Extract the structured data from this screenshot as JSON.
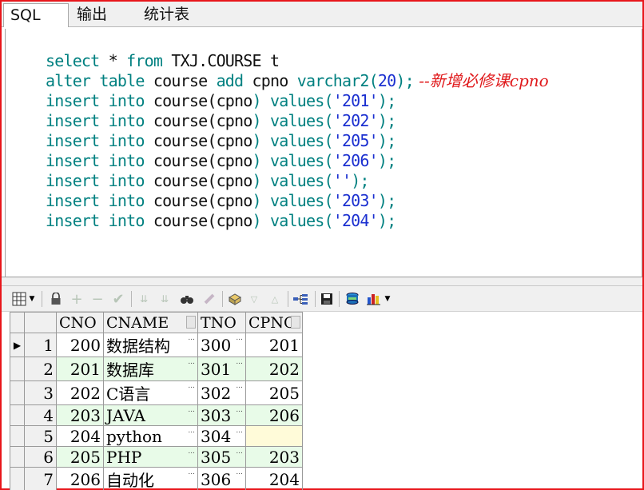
{
  "tabs": [
    {
      "label": "SQL"
    },
    {
      "label": "输出"
    },
    {
      "label": "统计表"
    }
  ],
  "editor": {
    "lines": [
      {
        "t1": "select",
        "t2": " * ",
        "t3": "from",
        "t4": " TXJ.COURSE t"
      },
      {
        "kw1": "alter table",
        "obj1": " course ",
        "kw2": "add",
        "obj2": " cpno ",
        "kw3": "varchar2(",
        "val": "20",
        "kw4": ");",
        "comment": " --新增必修课cpno"
      },
      {
        "kw1": "insert into",
        "obj1": " course",
        "kw2": "(",
        "obj2": "cpno",
        "kw3": ") values(",
        "val": "'201'",
        "kw4": ");"
      },
      {
        "kw1": "insert into",
        "obj1": " course",
        "kw2": "(",
        "obj2": "cpno",
        "kw3": ") values(",
        "val": "'202'",
        "kw4": ");"
      },
      {
        "kw1": "insert into",
        "obj1": " course",
        "kw2": "(",
        "obj2": "cpno",
        "kw3": ") values(",
        "val": "'205'",
        "kw4": ");"
      },
      {
        "kw1": "insert into",
        "obj1": " course",
        "kw2": "(",
        "obj2": "cpno",
        "kw3": ") values(",
        "val": "'206'",
        "kw4": ");"
      },
      {
        "kw1": "insert into",
        "obj1": " course",
        "kw2": "(",
        "obj2": "cpno",
        "kw3": ") values(",
        "val": "''",
        "kw4": ");"
      },
      {
        "kw1": "insert into",
        "obj1": " course",
        "kw2": "(",
        "obj2": "cpno",
        "kw3": ") values(",
        "val": "'203'",
        "kw4": ");"
      },
      {
        "kw1": "insert into",
        "obj1": " course",
        "kw2": "(",
        "obj2": "cpno",
        "kw3": ") values(",
        "val": "'204'",
        "kw4": ");"
      }
    ]
  },
  "toolbar": {
    "icons": [
      "grid-icon",
      "lock-icon",
      "add-record-icon",
      "delete-record-icon",
      "post-icon",
      "next-icon",
      "last-icon",
      "find-icon",
      "clear-icon",
      "query-by-example-icon",
      "filter-down-icon",
      "filter-up-icon",
      "link-icon",
      "save-icon",
      "export-icon",
      "chart-icon"
    ]
  },
  "grid": {
    "columns": [
      "CNO",
      "CNAME",
      "TNO",
      "CPNO"
    ],
    "rows": [
      {
        "num": "1",
        "cno": "200",
        "cname": "数据结构",
        "tno": "300",
        "cpno": "201"
      },
      {
        "num": "2",
        "cno": "201",
        "cname": "数据库",
        "tno": "301",
        "cpno": "202"
      },
      {
        "num": "3",
        "cno": "202",
        "cname": "C语言",
        "tno": "302",
        "cpno": "205"
      },
      {
        "num": "4",
        "cno": "203",
        "cname": "JAVA",
        "tno": "303",
        "cpno": "206"
      },
      {
        "num": "5",
        "cno": "204",
        "cname": "python",
        "tno": "304",
        "cpno": ""
      },
      {
        "num": "6",
        "cno": "205",
        "cname": "PHP",
        "tno": "305",
        "cpno": "203"
      },
      {
        "num": "7",
        "cno": "206",
        "cname": "自动化",
        "tno": "306",
        "cpno": "204"
      }
    ],
    "ellipsis": "..."
  },
  "colors": {
    "frame": "#e8161b",
    "keyword": "#008080",
    "value": "#1a2fd0",
    "comment": "#e0191b",
    "alt_row": "#e8fbe8",
    "edit_cell": "#fffbd9"
  }
}
